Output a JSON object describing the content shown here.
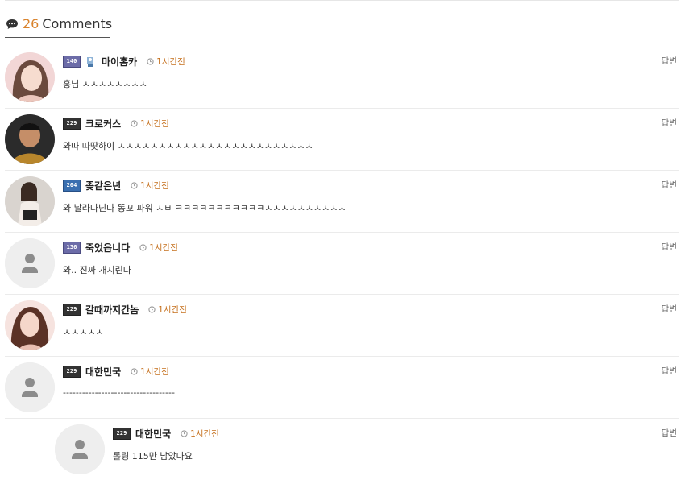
{
  "header": {
    "count": "26",
    "title": "Comments"
  },
  "comments": [
    {
      "nick": "마이홈카",
      "time": "1시간전",
      "text": "홍님 ㅅㅅㅅㅅㅅㅅㅅㅅ",
      "reply": "답변",
      "badge": "140",
      "avatar": "photo-pink"
    },
    {
      "nick": "크로커스",
      "time": "1시간전",
      "text": "와따 따땃하이 ㅅㅅㅅㅅㅅㅅㅅㅅㅅㅅㅅㅅㅅㅅㅅㅅㅅㅅㅅㅅㅅㅅㅅㅅ",
      "reply": "답변",
      "badge": "229",
      "avatar": "photo-dark"
    },
    {
      "nick": "좆같은년",
      "time": "1시간전",
      "text": "와 날라다닌다 똥꼬 파워 ㅅㅂ ㅋㅋㅋㅋㅋㅋㅋㅋㅋㅋㅋㅅㅅㅅㅅㅅㅅㅅㅅㅅㅅ",
      "reply": "답변",
      "badge": "204",
      "avatar": "photo-gray"
    },
    {
      "nick": "죽었읍니다",
      "time": "1시간전",
      "text": "와.. 진짜 개지린다",
      "reply": "답변",
      "badge": "136",
      "avatar": "default"
    },
    {
      "nick": "갈때까지간놈",
      "time": "1시간전",
      "text": "ㅅㅅㅅㅅㅅ",
      "reply": "답변",
      "badge": "229",
      "avatar": "photo-pink2"
    },
    {
      "nick": "대한민국",
      "time": "1시간전",
      "text": "-----------------------------------",
      "reply": "답변",
      "badge": "229",
      "avatar": "default"
    }
  ],
  "reply_comment": {
    "nick": "대한민국",
    "time": "1시간전",
    "text": "롤링 115만 남았다요",
    "reply": "답변",
    "badge": "229",
    "avatar": "default"
  }
}
